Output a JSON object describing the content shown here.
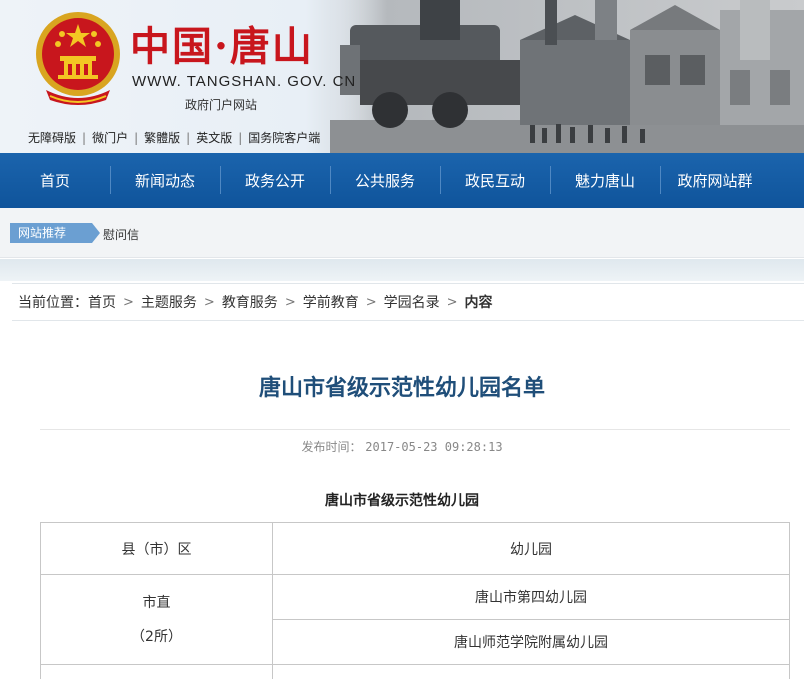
{
  "header": {
    "site_name": "中国·唐山",
    "url": "WWW. TANGSHAN. GOV. CN",
    "subtitle": "政府门户网站",
    "quick_links": [
      "无障碍版",
      "微门户",
      "繁體版",
      "英文版",
      "国务院客户端"
    ]
  },
  "nav": {
    "items": [
      "首页",
      "新闻动态",
      "政务公开",
      "公共服务",
      "政民互动",
      "魅力唐山",
      "政府网站群"
    ]
  },
  "recommend": {
    "tag": "网站推荐",
    "text": "慰问信"
  },
  "breadcrumb": {
    "label": "当前位置：",
    "items": [
      "首页",
      "主题服务",
      "教育服务",
      "学前教育",
      "学园名录"
    ],
    "current": "内容"
  },
  "article": {
    "title": "唐山市省级示范性幼儿园名单",
    "publish_label": "发布时间：",
    "publish_time": "2017-05-23 09:28:13",
    "table_title": "唐山市省级示范性幼儿园",
    "columns": [
      "县（市）区",
      "幼儿园"
    ],
    "groups": [
      {
        "county": "市直",
        "count": "（2所）",
        "schools": [
          "唐山市第四幼儿园",
          "唐山师范学院附属幼儿园"
        ]
      }
    ]
  },
  "colors": {
    "nav_blue": "#0f549b",
    "title_red": "#c8161d",
    "article_title": "#1f4e79",
    "tag_blue": "#6b9fd2"
  }
}
